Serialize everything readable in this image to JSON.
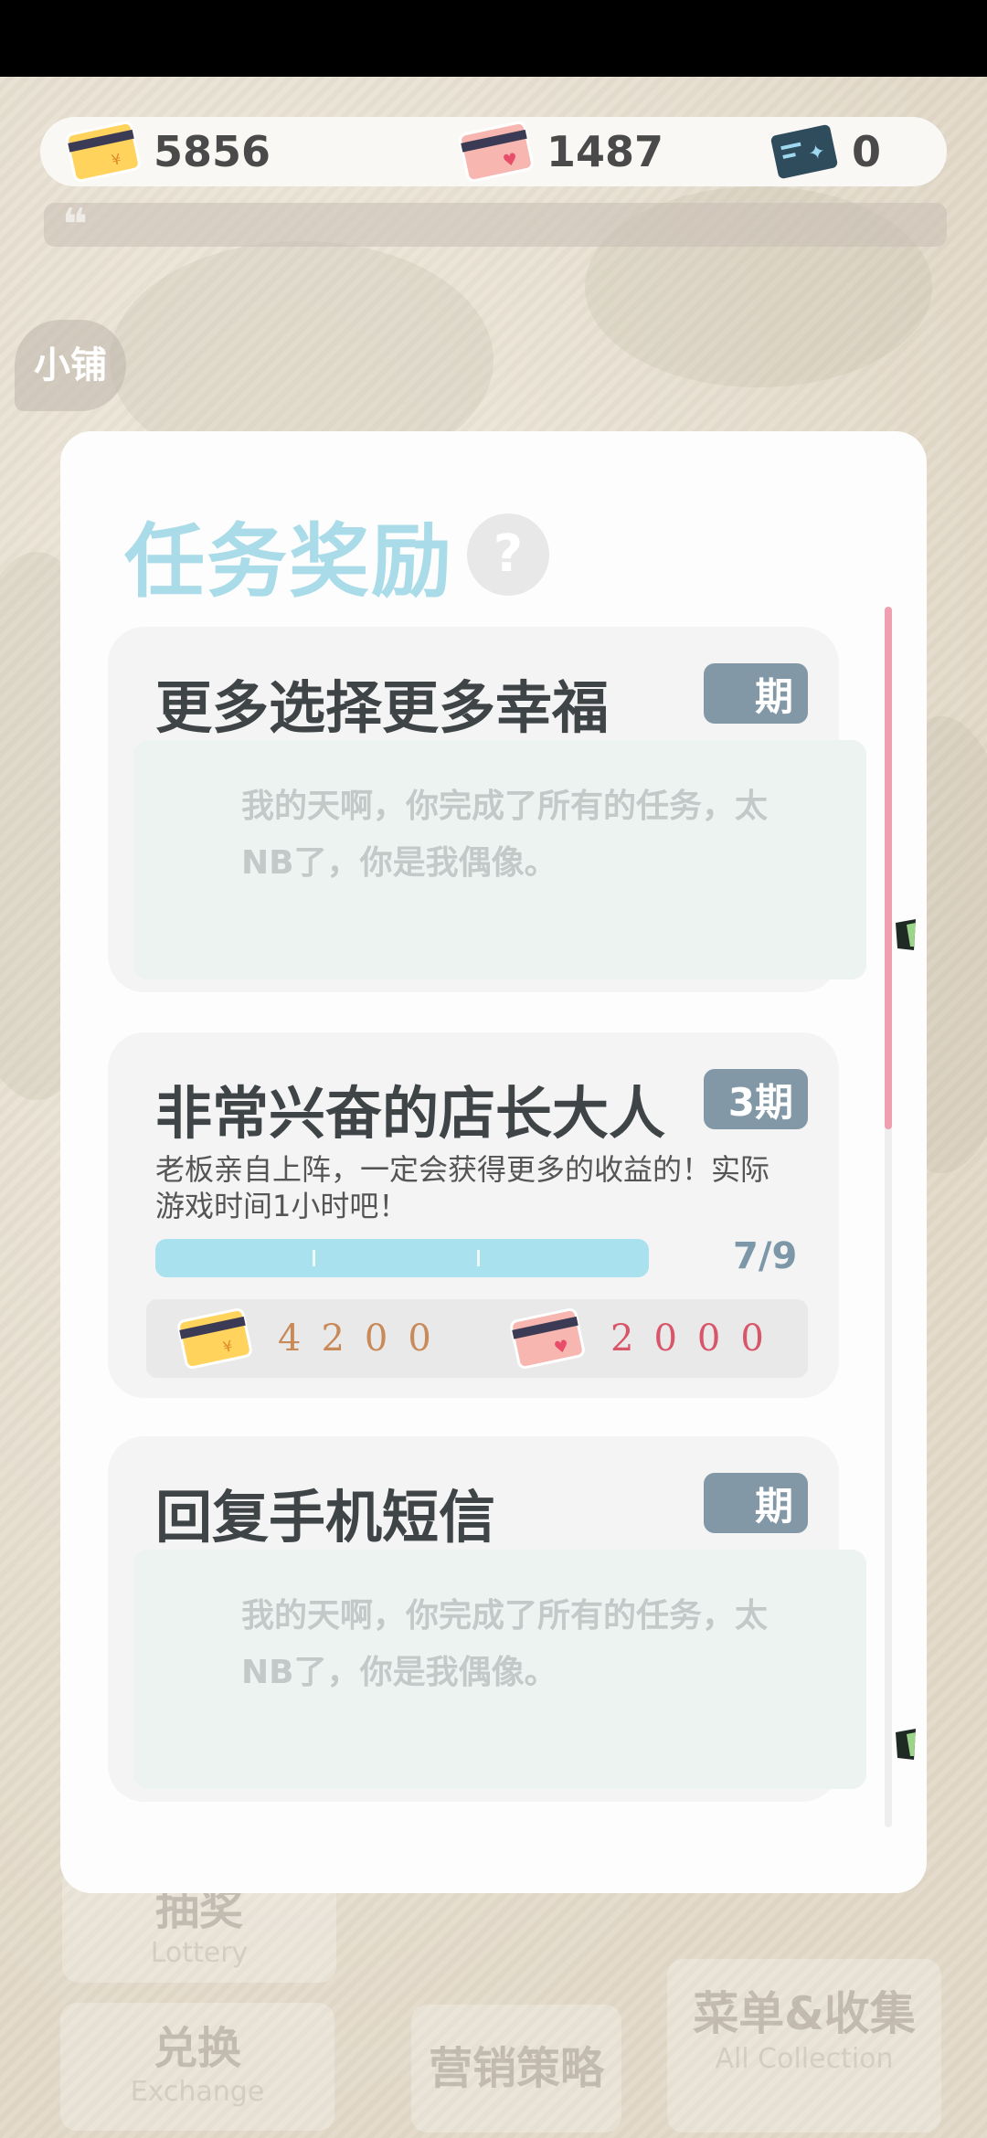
{
  "currency": {
    "gold_value": "5856",
    "pink_value": "1487",
    "ticket_value": "0"
  },
  "quote_mark": "❝",
  "background": {
    "shop_bubble": "小铺",
    "lottery_label": "抽奖",
    "lottery_sub": "Lottery",
    "exchange_label": "兑换",
    "exchange_sub": "Exchange",
    "marketing_label": "营销策略",
    "collection_label": "菜单&收集",
    "collection_sub": "All Collection"
  },
  "modal": {
    "title": "任务奖励",
    "help": "?"
  },
  "tasks": [
    {
      "title": "更多选择更多幸福",
      "period": "期",
      "done_text": "我的天啊，你完成了所有的任务，太NB了，你是我偶像。"
    },
    {
      "title": "非常兴奋的店长大人",
      "period": "3期",
      "description": "老板亲自上阵，一定会获得更多的收益的！实际游戏时间1小时吧！",
      "progress_text": "7/9",
      "progress_fraction": 0.778,
      "reward_gold": "4200",
      "reward_pink": "2000"
    },
    {
      "title": "回复手机短信",
      "period": "期",
      "done_text": "我的天啊，你完成了所有的任务，太NB了，你是我偶像。"
    }
  ],
  "colors": {
    "title": "#a9dce8",
    "badge": "#8298a6",
    "progress": "#a9e2ee",
    "scroll_thumb": "#ef9fb0",
    "gold_amount": "#c98a5a",
    "pink_amount": "#d8566a"
  }
}
